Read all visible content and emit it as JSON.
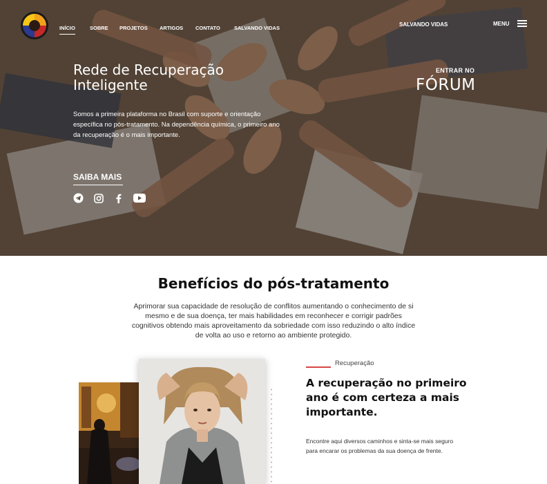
{
  "header": {
    "nav": [
      {
        "label": "INÍCIO",
        "active": true
      },
      {
        "label": "SOBRE",
        "active": false
      },
      {
        "label": "PROJETOS",
        "active": false
      },
      {
        "label": "ARTIGOS",
        "active": false
      },
      {
        "label": "CONTATO",
        "active": false
      },
      {
        "label": "SALVANDO VIDAS",
        "active": false
      }
    ],
    "cta_label": "SALVANDO VIDAS",
    "menu_label": "MENU",
    "logo_icon": "logo-icon",
    "menu_icon": "hamburger-icon"
  },
  "hero": {
    "title": "Rede de Recuperação Inteligente",
    "text": "Somos a primeira plataforma no Brasil com suporte e orientação específica no pós-tratamento. Na dependência química, o primeiro ano da recuperação é o mais importante.",
    "forum_small": "ENTRAR NO",
    "forum_big": "FÓRUM",
    "saiba_mais": "SAIBA MAIS",
    "social_icons": [
      "telegram-icon",
      "instagram-icon",
      "facebook-icon",
      "youtube-icon"
    ]
  },
  "benefits": {
    "title": "Benefícios do pós-tratamento",
    "text": "Aprimorar sua capacidade de resolução de conflitos aumentando o conhecimento de si mesmo e de sua doença, ter mais habilidades em reconhecer e corrigir padrões cognitivos obtendo mais aproveitamento da sobriedade com isso reduzindo o alto índice de volta ao uso e retorno ao ambiente protegido."
  },
  "feature": {
    "eyebrow": "Recuperação",
    "title": "A recuperação no primeiro ano é com certeza a mais importante.",
    "text": "Encontre aqui diversos caminhos e sinta-se mais seguro para encarar os problemas da sua doença de frente."
  },
  "colors": {
    "accent": "#d84444",
    "hero_overlay": "#1e1610"
  }
}
